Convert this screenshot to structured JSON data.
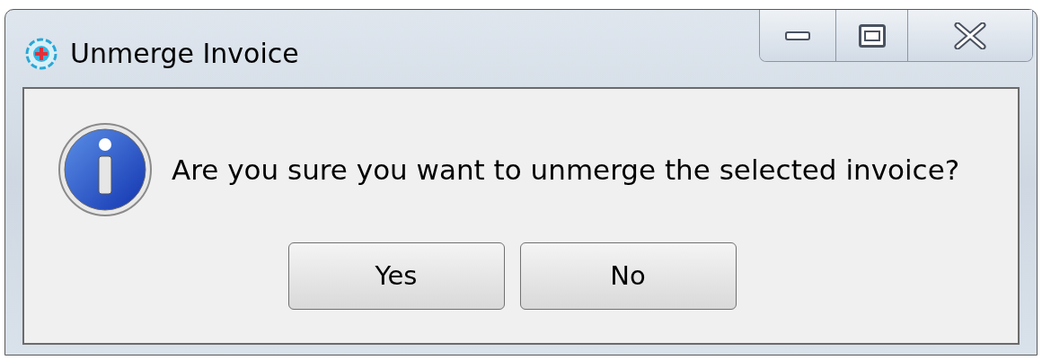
{
  "window": {
    "title": "Unmerge Invoice"
  },
  "message": "Are you sure you want to unmerge the selected invoice?",
  "buttons": [
    {
      "label": "Yes"
    },
    {
      "label": "No"
    }
  ]
}
